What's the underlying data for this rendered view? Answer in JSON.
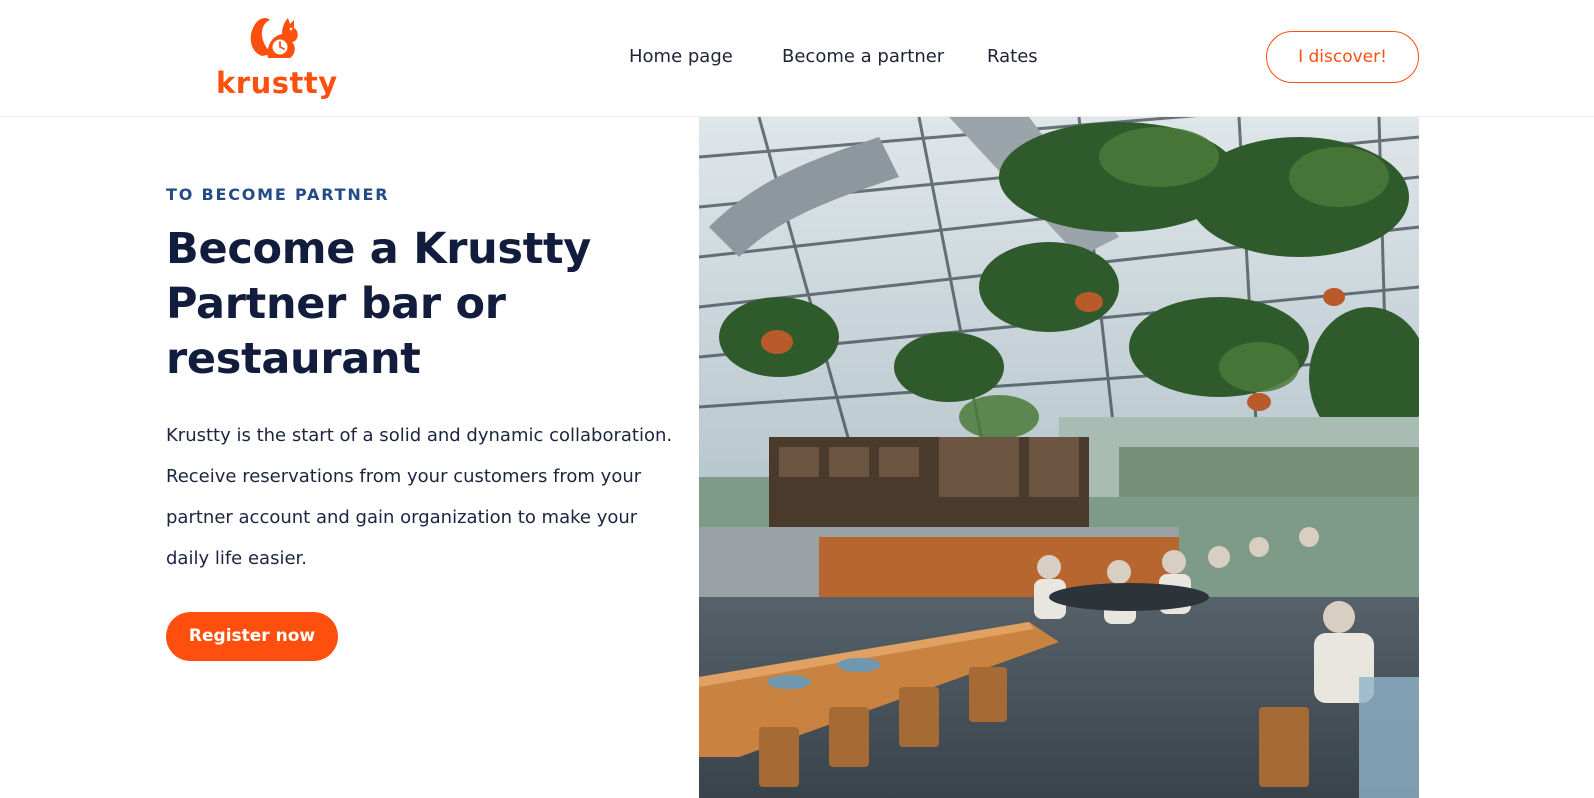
{
  "brand": {
    "name": "krustty",
    "accent_color": "#ff4f0f",
    "logo_icon": "squirrel-clock-icon"
  },
  "nav": {
    "items": [
      {
        "label": "Home page"
      },
      {
        "label": "Become a partner"
      },
      {
        "label": "Rates"
      }
    ],
    "cta_label": "I discover!"
  },
  "hero": {
    "eyebrow": "TO BECOME PARTNER",
    "title": "Become a Krustty Partner bar or restaurant",
    "description": "Krustty is the start of a solid and dynamic collaboration. Receive reservations from your customers from your partner account and gain organization to make your daily life easier.",
    "button_label": "Register now",
    "image_subject": "greenhouse-restaurant-photo"
  },
  "colors": {
    "heading": "#121c3d",
    "eyebrow": "#234b86",
    "accent": "#ff4f0f"
  }
}
